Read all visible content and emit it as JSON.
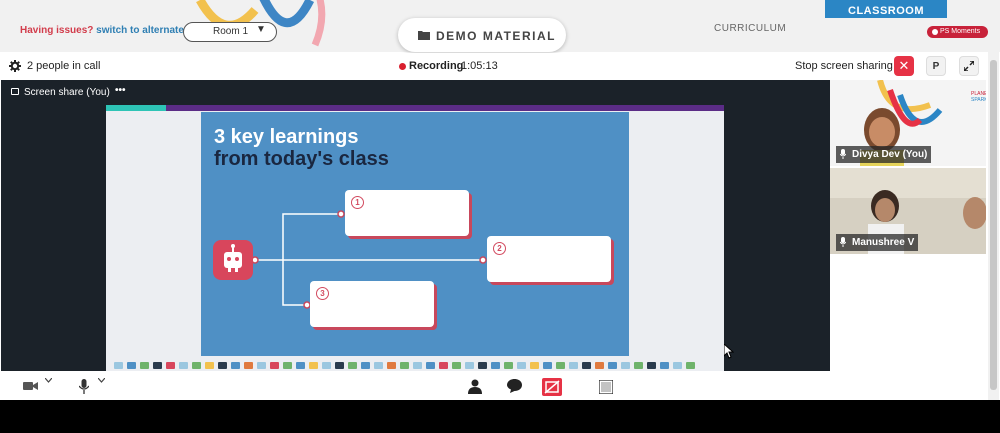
{
  "topbar": {
    "issue_prefix": "Having issues?",
    "issue_link": "switch to alternate room",
    "room_select_value": "Room 1",
    "room_select_arrow": "▼",
    "demo_material_label": "DEMO MATERIAL",
    "curriculum_label": "CURRICULUM",
    "classroom_label": "CLASSROOM",
    "ps_moments_label": "PS Moments"
  },
  "call": {
    "people_count_text": "2 people in call",
    "recording_label": "Recording",
    "recording_time": "1:05:13",
    "stop_sharing_label": "Stop screen sharing",
    "stop_icon": "✕",
    "p_button_label": "P",
    "screen_share_label": "Screen share (You)",
    "more_label": "•••"
  },
  "slide": {
    "title_line1": "3 key learnings",
    "title_line2": "from today's class",
    "numbers": [
      "1",
      "2",
      "3"
    ]
  },
  "participants": [
    {
      "name": "Divya Dev (You)"
    },
    {
      "name": "Manushree V"
    }
  ],
  "colors": {
    "accent_red": "#e63245",
    "slide_blue": "#4f90c5",
    "classroom_blue": "#2b86c5",
    "recording_red": "#d91f2e"
  }
}
